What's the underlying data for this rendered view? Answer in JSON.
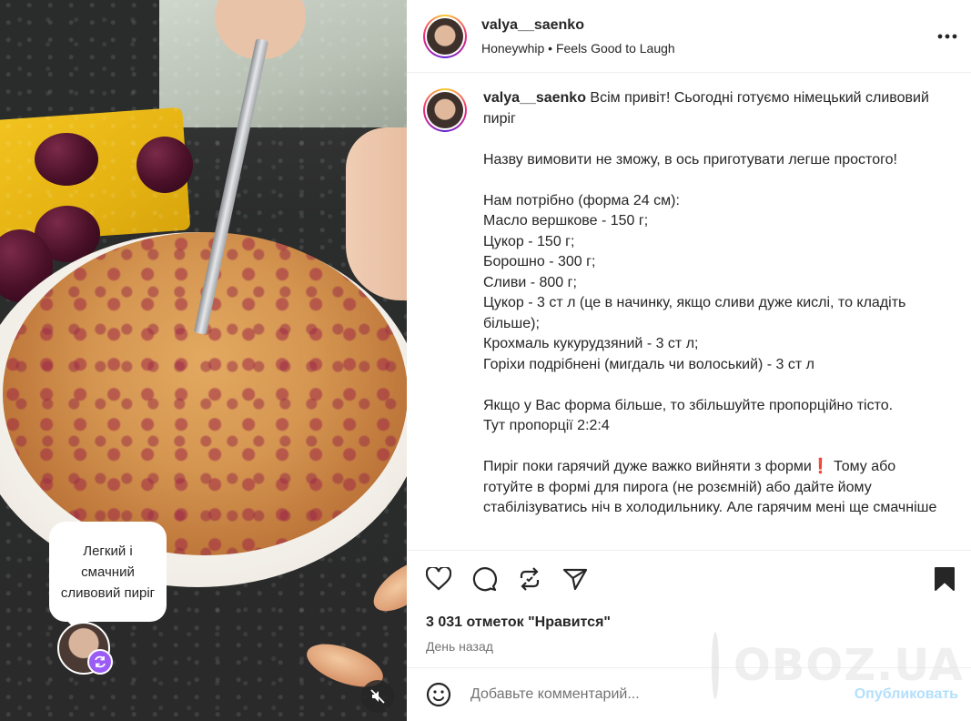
{
  "media": {
    "bubble_text": "Легкий і смачний сливовий пиріг"
  },
  "header": {
    "username": "valya__saenko",
    "subline": "Honeywhip • Feels Good to Laugh",
    "more_icon": "more-horizontal-icon"
  },
  "caption": {
    "username": "valya__saenko",
    "first_line": " Всім привіт! Сьогодні готуємо німецький сливовий пиріг",
    "lines": [
      "",
      "Назву вимовити не зможу, в ось приготувати легше простого!",
      "",
      "Нам потрібно (форма 24 см):",
      "Масло вершкове - 150 г;",
      "Цукор - 150 г;",
      "Борошно - 300 г;",
      "Сливи - 800 г;",
      "Цукор - 3 ст л (це в начинку, якщо сливи дуже кислі, то кладіть більше);",
      "Крохмаль кукурудзяний - 3 ст л;",
      "Горіхи подрібнені (мигдаль чи волоський) - 3 ст л",
      "",
      "Якщо у Вас форма більше, то збільшуйте пропорційно тісто.",
      "Тут пропорції 2:2:4",
      ""
    ],
    "last_before": "Пиріг поки гарячий дуже важко вийняти з форми",
    "last_mark": "❗",
    "last_after": " Тому або готуйте в формі для пирога (не розємній) або дайте йому стабілізуватись ніч в холодильнику. Але гарячим мені ще смачніше"
  },
  "actions": {
    "likes": "3 031 отметок \"Нравится\"",
    "time": "День назад"
  },
  "comment": {
    "placeholder": "Добавьте комментарий...",
    "publish": "Опубликовать"
  },
  "watermark": {
    "text": "OBOZ.UA"
  },
  "colors": {
    "link_blue": "#b2dffc",
    "text": "#262626",
    "muted": "#737373",
    "remix_purple": "#9b5cf6"
  }
}
